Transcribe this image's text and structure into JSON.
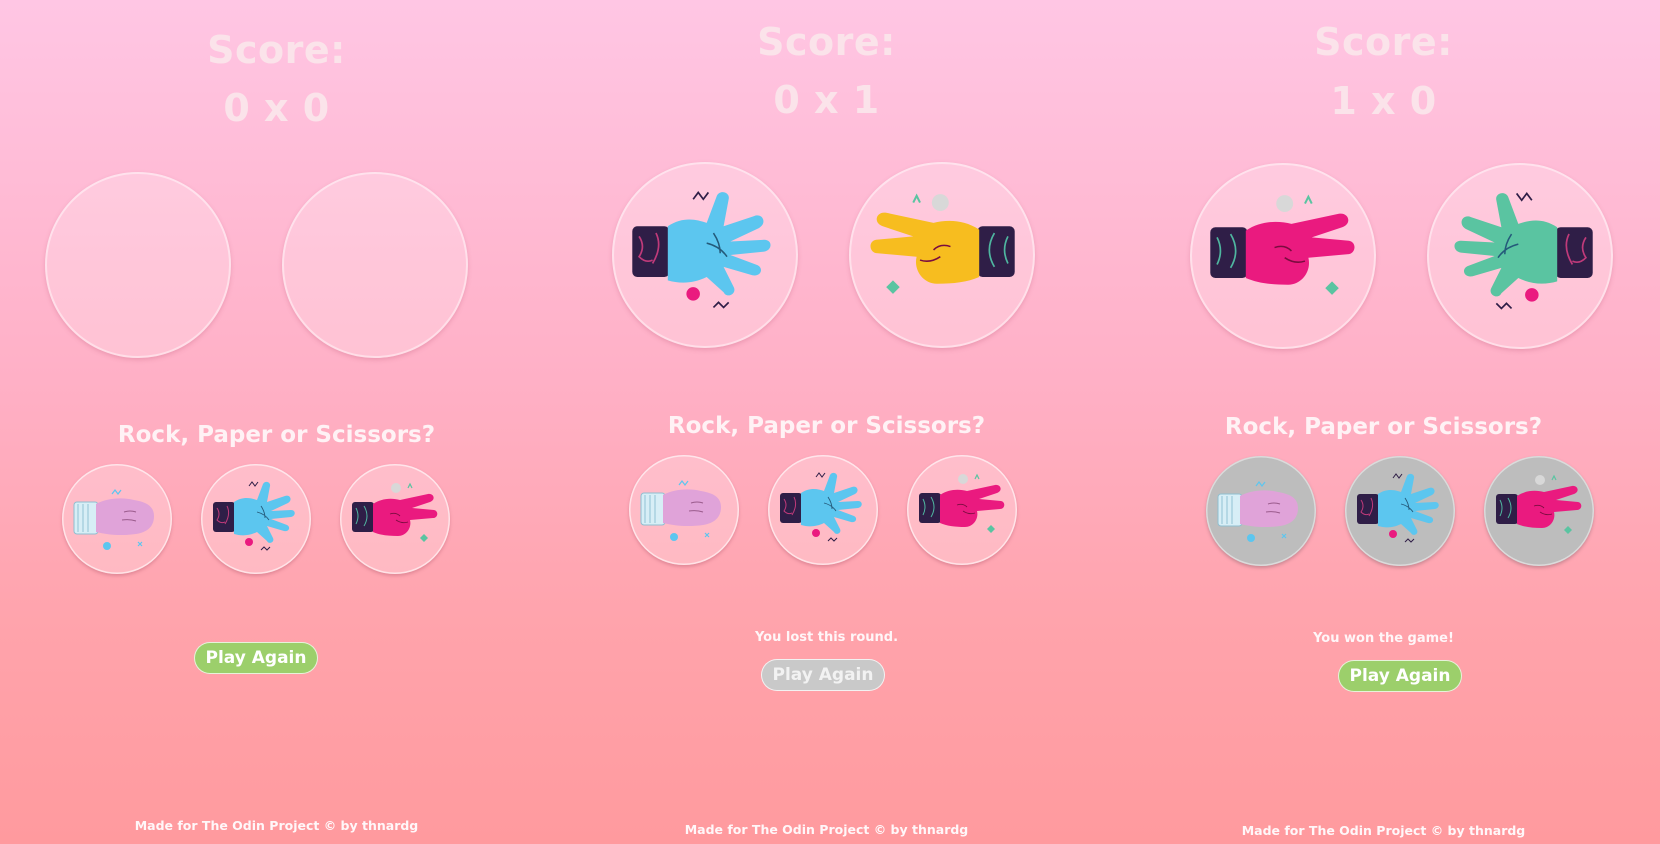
{
  "panels": [
    {
      "score_title": "Score:",
      "score_value": "0 x 0",
      "player_hand": "",
      "computer_hand": "",
      "question": "Rock, Paper or Scissors?",
      "choices": [
        {
          "name": "rock",
          "icon": "rock-hand-icon"
        },
        {
          "name": "paper",
          "icon": "paper-hand-icon"
        },
        {
          "name": "scissors",
          "icon": "scissors-hand-icon"
        }
      ],
      "choices_disabled": false,
      "status": "",
      "play_again_label": "Play Again",
      "play_again_disabled": false,
      "footer": "Made for The Odin Project © by thnardg"
    },
    {
      "score_title": "Score:",
      "score_value": "0 x 1",
      "player_hand": "paper-hand-icon",
      "computer_hand": "scissors-hand-icon",
      "question": "Rock, Paper or Scissors?",
      "choices": [
        {
          "name": "rock",
          "icon": "rock-hand-icon"
        },
        {
          "name": "paper",
          "icon": "paper-hand-icon"
        },
        {
          "name": "scissors",
          "icon": "scissors-hand-icon"
        }
      ],
      "choices_disabled": false,
      "status": "You lost this round.",
      "play_again_label": "Play Again",
      "play_again_disabled": true,
      "footer": "Made for The Odin Project © by thnardg"
    },
    {
      "score_title": "Score:",
      "score_value": "1 x 0",
      "player_hand": "scissors-hand-icon",
      "computer_hand": "paper-hand-icon",
      "question": "Rock, Paper or Scissors?",
      "choices": [
        {
          "name": "rock",
          "icon": "rock-hand-icon"
        },
        {
          "name": "paper",
          "icon": "paper-hand-icon"
        },
        {
          "name": "scissors",
          "icon": "scissors-hand-icon"
        }
      ],
      "choices_disabled": true,
      "status": "You won the game!",
      "play_again_label": "Play Again",
      "play_again_disabled": false,
      "footer": "Made for The Odin Project © by thnardg"
    }
  ],
  "colors": {
    "rock_hand": "#e0a3d9",
    "paper_hand_player": "#5cc6ef",
    "scissors_hand_player": "#ea1a7f",
    "paper_hand_computer": "#5ac4a1",
    "scissors_hand_computer": "#f7bd1f",
    "cuff": "#2f1e47",
    "play_again_active": "#9ccf6b",
    "play_again_disabled": "#c9c9c9",
    "choice_disabled": "#bdbdbd"
  }
}
